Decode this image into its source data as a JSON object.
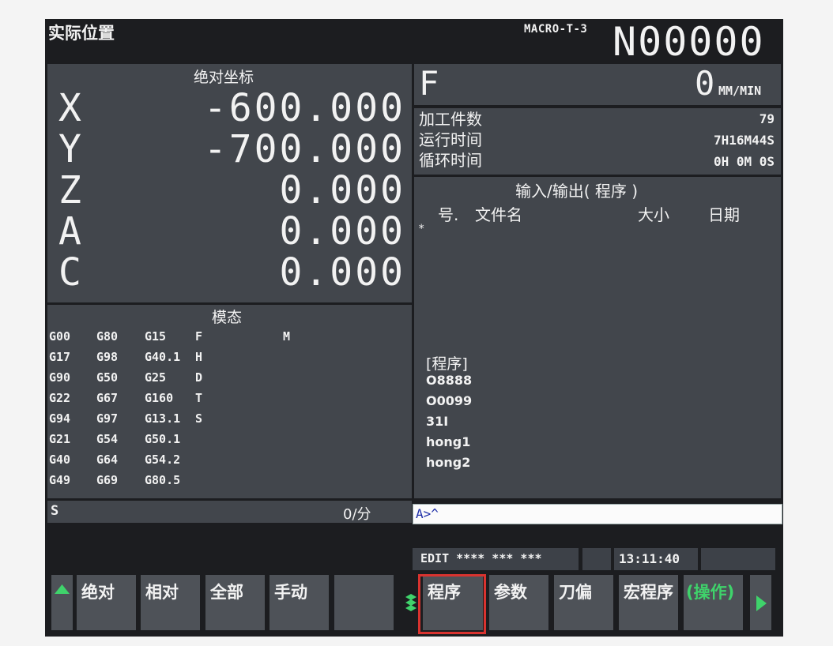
{
  "header": {
    "title": "实际位置",
    "program_name": "MACRO-T-3",
    "sequence_number": "N00000"
  },
  "coordinates": {
    "title": "绝对坐标",
    "axes": [
      {
        "name": "X",
        "value": "-600.000"
      },
      {
        "name": "Y",
        "value": "-700.000"
      },
      {
        "name": "Z",
        "value": "0.000"
      },
      {
        "name": "A",
        "value": "0.000"
      },
      {
        "name": "C",
        "value": "0.000"
      }
    ]
  },
  "modal": {
    "title": "模态",
    "rows": [
      [
        "G00",
        "G80",
        "G15",
        "F",
        "M"
      ],
      [
        "G17",
        "G98",
        "G40.1",
        "H",
        ""
      ],
      [
        "G90",
        "G50",
        "G25",
        "D",
        ""
      ],
      [
        "G22",
        "G67",
        "G160",
        "T",
        ""
      ],
      [
        "G94",
        "G97",
        "G13.1",
        "S",
        ""
      ],
      [
        "G21",
        "G54",
        "G50.1",
        "",
        ""
      ],
      [
        "G40",
        "G64",
        "G54.2",
        "",
        ""
      ],
      [
        "G49",
        "G69",
        "G80.5",
        "",
        ""
      ]
    ]
  },
  "feed": {
    "label": "F",
    "value": "0",
    "unit": "MM/MIN"
  },
  "counters": [
    {
      "label": "加工件数",
      "value": "79"
    },
    {
      "label": "运行时间",
      "value": "7H16M44S"
    },
    {
      "label": "循环时间",
      "value": "0H 0M 0S"
    }
  ],
  "io": {
    "title": "输入/输出( 程序 )",
    "columns": {
      "no": "号.",
      "file": "文件名",
      "size": "大小",
      "date": "日期"
    },
    "cursor_mark": "*",
    "program_header": "[程序]",
    "programs": [
      "O8888",
      "O0099",
      "31I",
      "hong1",
      "hong2"
    ]
  },
  "spindle": {
    "label": "S",
    "value": "0/分"
  },
  "input_line": {
    "text": "A>^"
  },
  "status": {
    "mode": "EDIT **** *** ***",
    "time": "13:11:40"
  },
  "softkeys": {
    "left": [
      "绝对",
      "相对",
      "全部",
      "手动",
      ""
    ],
    "right": [
      "程序",
      "参数",
      "刀偏",
      "宏程序",
      "(操作)"
    ]
  },
  "colors": {
    "screen_bg": "#1c1d20",
    "panel_bg": "#42464c",
    "softkey_bg": "#4e5258",
    "text": "#f2f2f2",
    "accent_green": "#3fd36b",
    "highlight_red": "#d9332f"
  }
}
